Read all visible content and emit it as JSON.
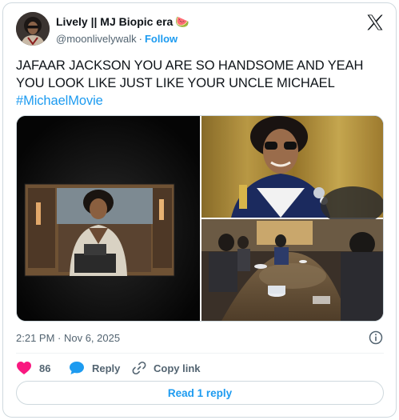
{
  "author": {
    "name": "Lively || MJ Biopic era",
    "emoji": "🍉",
    "handle": "@moonlivelywalk",
    "separator": "·",
    "follow_label": "Follow"
  },
  "brand": {
    "logo_icon": "x-logo-icon"
  },
  "tweet": {
    "text": "JAFAAR JACKSON YOU ARE SO HANDSOME AND YEAH YOU LOOK LIKE JUST LIKE YOUR UNCLE MICHAEL",
    "hashtag": "#MichaelMovie"
  },
  "media": {
    "images": [
      {
        "name": "photo-cinema-screen"
      },
      {
        "name": "photo-sunglasses-closeup"
      },
      {
        "name": "photo-boardroom-table"
      }
    ]
  },
  "meta": {
    "timestamp": "2:21 PM · Nov 6, 2025",
    "info_icon": "info-icon"
  },
  "actions": {
    "like_count": "86",
    "reply_label": "Reply",
    "copy_label": "Copy link"
  },
  "read_replies_label": "Read 1 reply",
  "colors": {
    "accent": "#1d9bf0",
    "like": "#f91880",
    "text_primary": "#0f1419",
    "text_secondary": "#536471",
    "border": "#cfd9de"
  }
}
